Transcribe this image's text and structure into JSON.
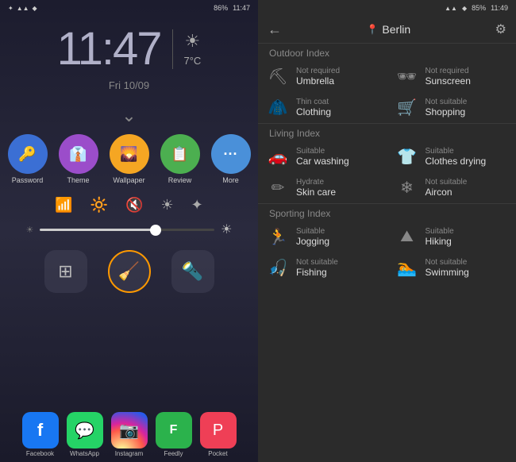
{
  "left": {
    "status": {
      "icons": "★ ✦ ◆",
      "battery": "86%",
      "time": "11:47"
    },
    "clock": "11:47",
    "date": "Fri 10/09",
    "temp": "7°C",
    "chevron": "⌄",
    "apps": [
      {
        "label": "Password",
        "color": "#3b6fd4",
        "icon": "🔑"
      },
      {
        "label": "Theme",
        "color": "#9b4dca",
        "icon": "👔"
      },
      {
        "label": "Wallpaper",
        "color": "#f5a623",
        "icon": "🖼"
      },
      {
        "label": "Review",
        "color": "#4caf50",
        "icon": "📝"
      },
      {
        "label": "More",
        "color": "#4a90d9",
        "icon": "···"
      }
    ],
    "quickSettings": [
      "wifi",
      "screen",
      "volume",
      "brightness",
      "bluetooth"
    ],
    "bottomIcons": [
      "grid",
      "broom",
      "flashlight"
    ],
    "dock": [
      {
        "label": "Facebook",
        "color": "#1877f2",
        "icon": "f"
      },
      {
        "label": "WhatsApp",
        "color": "#25d366",
        "icon": "W"
      },
      {
        "label": "Instagram",
        "color": "#c13584",
        "icon": "📷"
      },
      {
        "label": "Feedly",
        "color": "#2bb24c",
        "icon": "F"
      },
      {
        "label": "Pocket",
        "color": "#ef3f56",
        "icon": "P"
      }
    ]
  },
  "right": {
    "status": {
      "battery": "85%",
      "time": "11:49"
    },
    "header": {
      "back_icon": "←",
      "location_icon": "📍",
      "location": "Berlin",
      "settings_icon": "⚙"
    },
    "sections": [
      {
        "title": "Outdoor Index",
        "items": [
          {
            "status": "Not required",
            "label": "Umbrella",
            "icon": "⛏"
          },
          {
            "status": "Not required",
            "label": "Sunscreen",
            "icon": "🕶"
          },
          {
            "status": "Thin coat",
            "label": "Clothing",
            "icon": "👔"
          },
          {
            "status": "Not suitable",
            "label": "Shopping",
            "icon": "🛒"
          }
        ]
      },
      {
        "title": "Living Index",
        "items": [
          {
            "status": "Suitable",
            "label": "Car washing",
            "icon": "🚗"
          },
          {
            "status": "Suitable",
            "label": "Clothes drying",
            "icon": "👕"
          },
          {
            "status": "Hydrate",
            "label": "Skin care",
            "icon": "✏"
          },
          {
            "status": "Not suitable",
            "label": "Aircon",
            "icon": "❄"
          }
        ]
      },
      {
        "title": "Sporting Index",
        "items": [
          {
            "status": "Suitable",
            "label": "Jogging",
            "icon": "🏃"
          },
          {
            "status": "Suitable",
            "label": "Hiking",
            "icon": "🏔"
          },
          {
            "status": "Not suitable",
            "label": "Fishing",
            "icon": "🎣"
          },
          {
            "status": "Not suitable",
            "label": "Swimming",
            "icon": "🏊"
          }
        ]
      }
    ]
  }
}
